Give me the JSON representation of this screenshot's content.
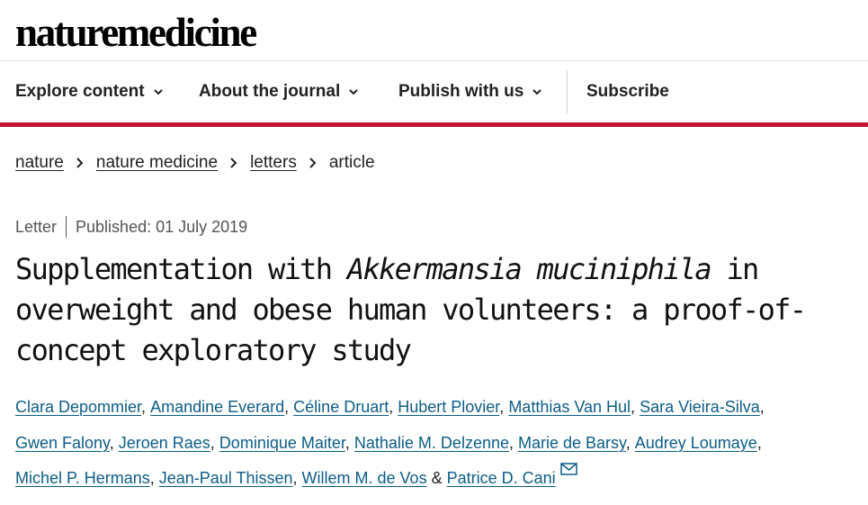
{
  "site": {
    "logo_text": "naturemedicine"
  },
  "nav": {
    "items": [
      {
        "label": "Explore content",
        "has_dropdown": true
      },
      {
        "label": "About the journal",
        "has_dropdown": true
      },
      {
        "label": "Publish with us",
        "has_dropdown": true
      },
      {
        "label": "Subscribe",
        "has_dropdown": false
      }
    ],
    "accent_color": "#c5122b"
  },
  "breadcrumb": {
    "items": [
      {
        "label": "nature",
        "link": true
      },
      {
        "label": "nature medicine",
        "link": true
      },
      {
        "label": "letters",
        "link": true
      },
      {
        "label": "article",
        "link": false
      }
    ]
  },
  "article": {
    "type": "Letter",
    "published": "Published: 01 July 2019",
    "title": {
      "before": "Supplementation with ",
      "italic": "Akkermansia muciniphila",
      "after": " in overweight and obese human volunteers: a proof-of-concept exploratory study"
    },
    "authors": {
      "names": [
        "Clara Depommier",
        "Amandine Everard",
        "Céline Druart",
        "Hubert Plovier",
        "Matthias Van Hul",
        "Sara Vieira-Silva",
        "Gwen Falony",
        "Jeroen Raes",
        "Dominique Maiter",
        "Nathalie M. Delzenne",
        "Marie de Barsy",
        "Audrey Loumaye",
        "Michel P. Hermans",
        "Jean-Paul Thissen",
        "Willem M. de Vos",
        "Patrice D. Cani"
      ],
      "separator": ", ",
      "final_conjunction": " & ",
      "corresponding_icon": "envelope-icon",
      "link_color": "#0c5d88"
    }
  }
}
